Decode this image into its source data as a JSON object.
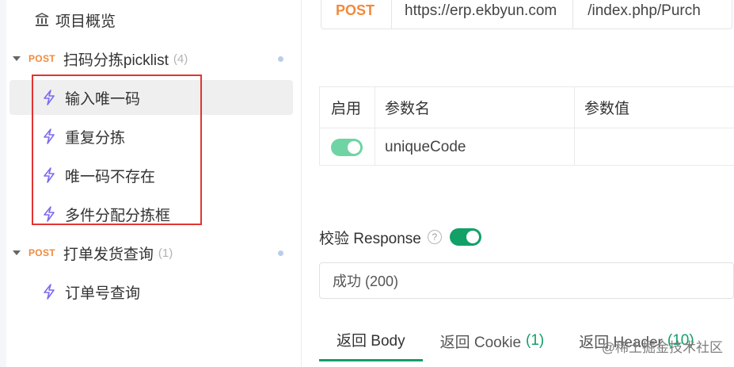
{
  "sidebar": {
    "overview_label": "项目概览",
    "groups": [
      {
        "method": "POST",
        "name": "扫码分拣picklist",
        "count": "(4)",
        "items": [
          "输入唯一码",
          "重复分拣",
          "唯一码不存在",
          "多件分配分拣框"
        ]
      },
      {
        "method": "POST",
        "name": "打单发货查询",
        "count": "(1)",
        "items": [
          "订单号查询"
        ]
      }
    ]
  },
  "request": {
    "method": "POST",
    "host": "https://erp.ekbyun.com",
    "path": "/index.php/Purch"
  },
  "params": {
    "headers": [
      "启用",
      "参数名",
      "参数值"
    ],
    "rows": [
      {
        "enabled": true,
        "name": "uniqueCode",
        "value": ""
      }
    ]
  },
  "verify": {
    "label": "校验 Response",
    "help": "?",
    "enabled": true
  },
  "response_select": {
    "value": "成功 (200)"
  },
  "tabs": [
    {
      "label": "返回 Body",
      "count": ""
    },
    {
      "label": "返回 Cookie",
      "count": "(1)"
    },
    {
      "label": "返回 Header",
      "count": "(10)"
    }
  ],
  "watermark": "@稀土掘金技术社区",
  "colors": {
    "accent": "#12a067",
    "method": "#f08a3d",
    "highlight_box": "#e33333"
  }
}
